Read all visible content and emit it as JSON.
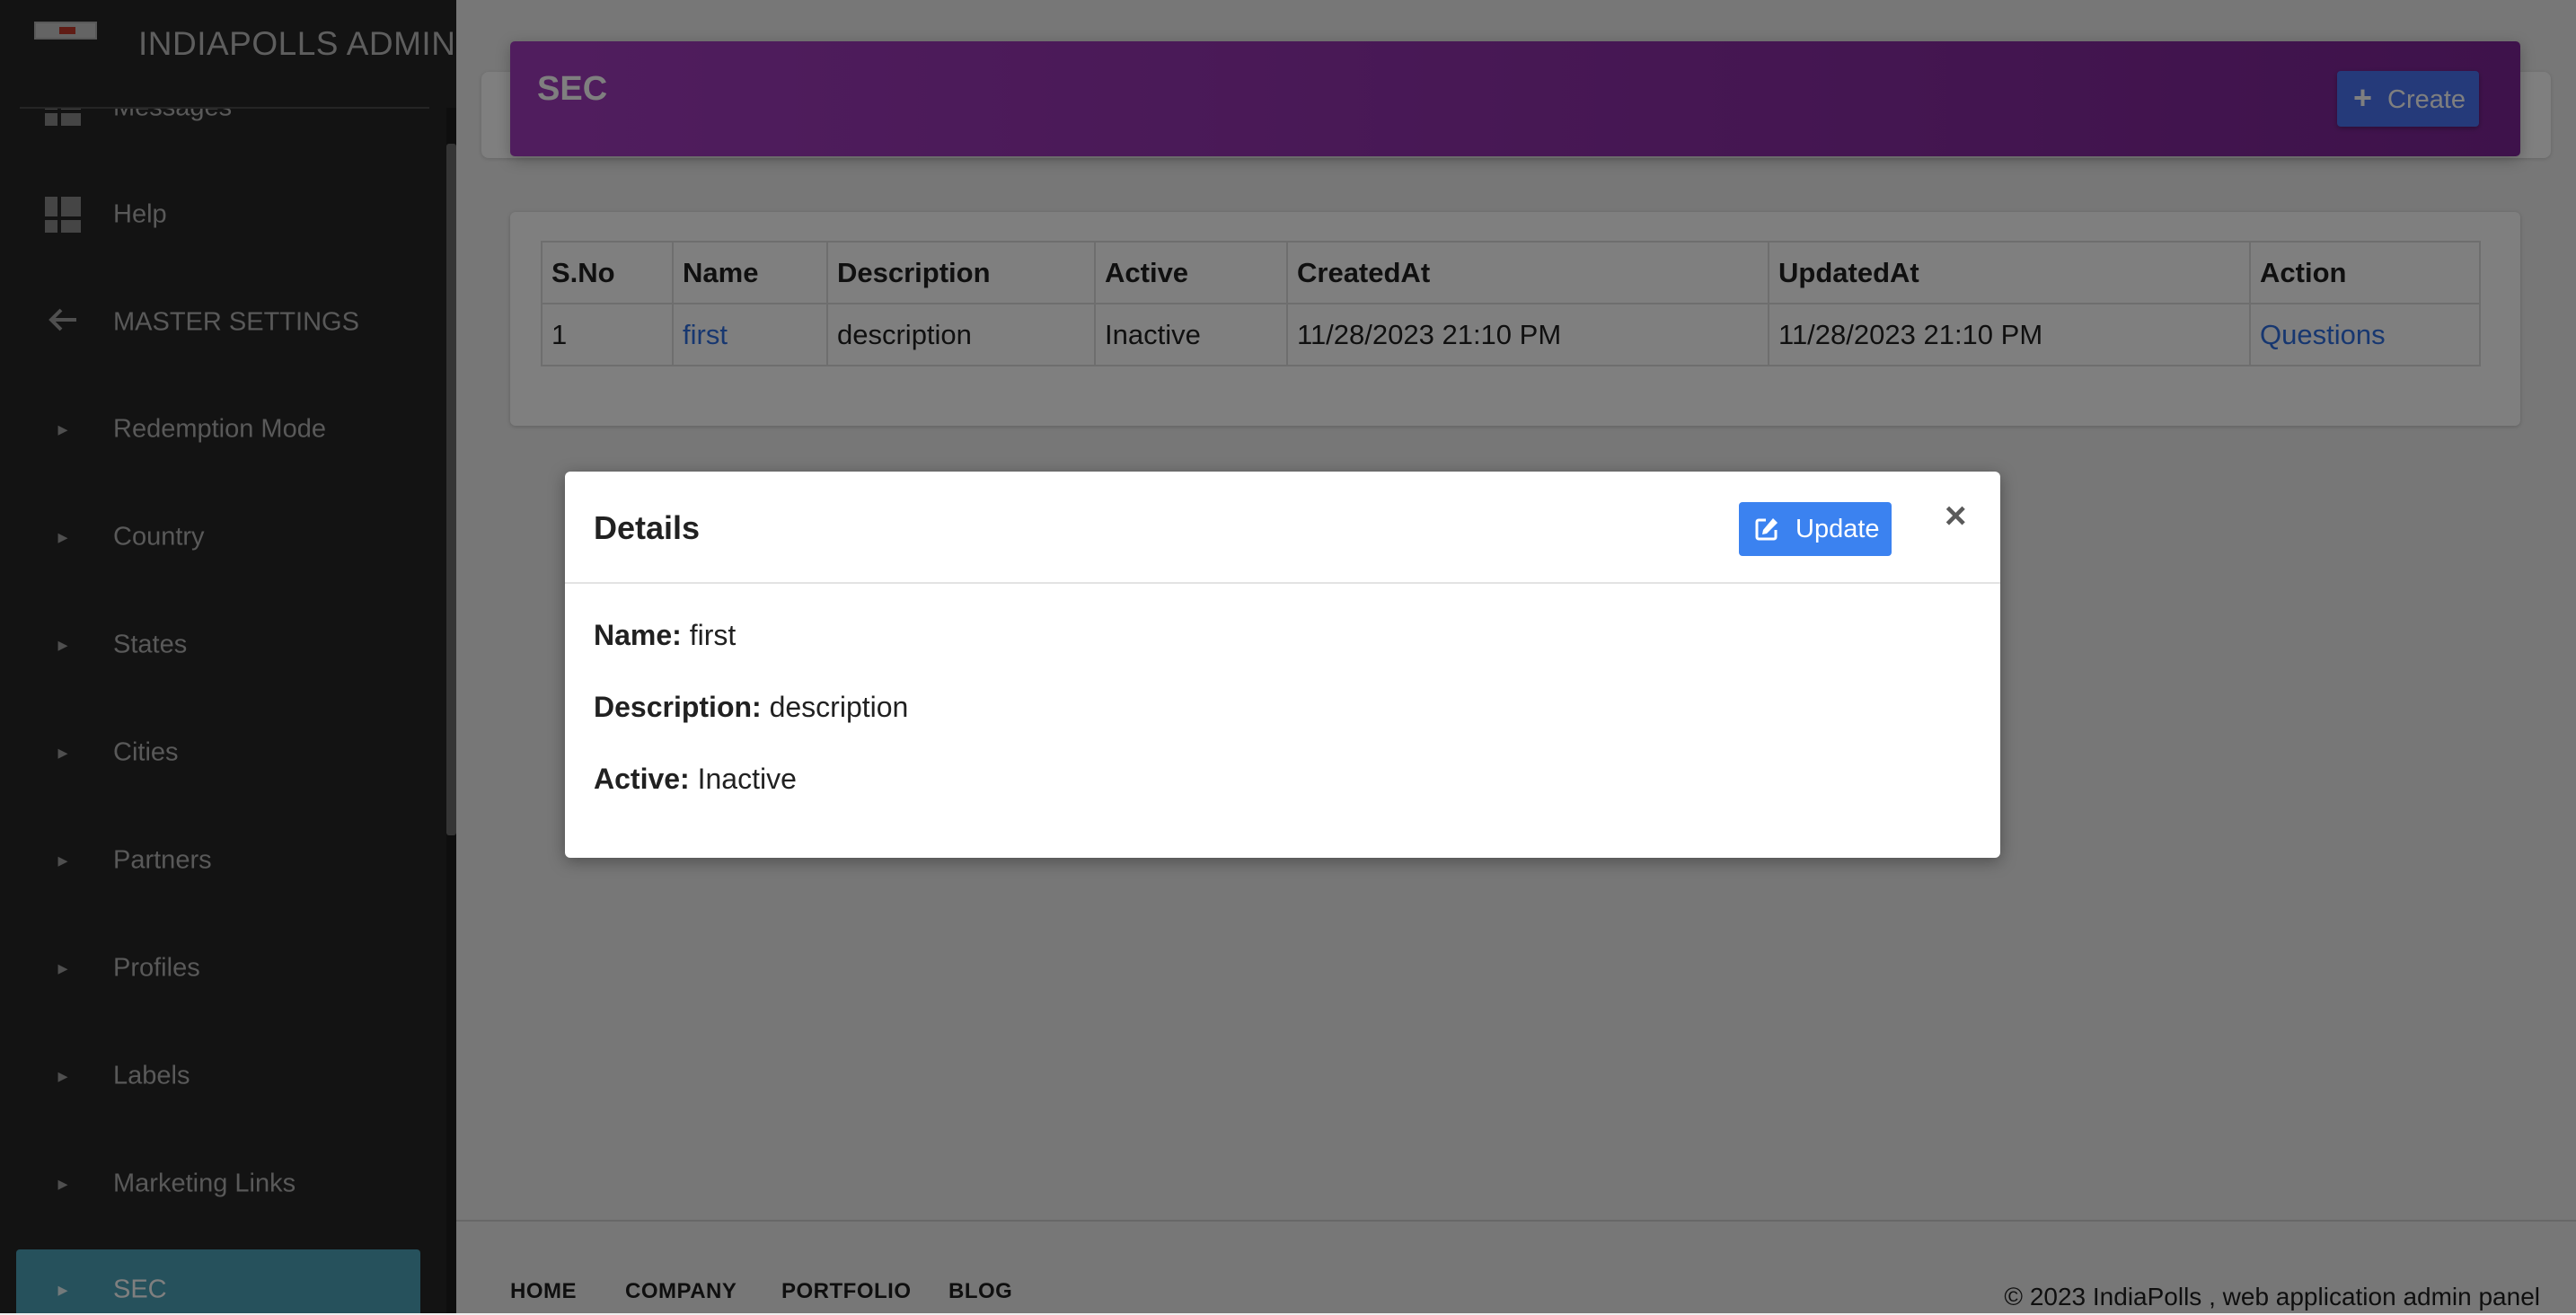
{
  "sidebar": {
    "brand": "INDIAPOLLS ADMIN",
    "items": [
      {
        "label": "Messages",
        "icon": "dashboard-icon"
      },
      {
        "label": "Help",
        "icon": "dashboard-icon"
      },
      {
        "label": "MASTER SETTINGS",
        "icon": "arrow-left-icon"
      },
      {
        "label": "Redemption Mode",
        "icon": "caret-right-icon"
      },
      {
        "label": "Country",
        "icon": "caret-right-icon"
      },
      {
        "label": "States",
        "icon": "caret-right-icon"
      },
      {
        "label": "Cities",
        "icon": "caret-right-icon"
      },
      {
        "label": "Partners",
        "icon": "caret-right-icon"
      },
      {
        "label": "Profiles",
        "icon": "caret-right-icon"
      },
      {
        "label": "Labels",
        "icon": "caret-right-icon"
      },
      {
        "label": "Marketing Links",
        "icon": "caret-right-icon"
      },
      {
        "label": "SEC",
        "icon": "caret-right-icon",
        "active": true
      }
    ]
  },
  "header": {
    "title": "SEC",
    "create_label": "Create"
  },
  "table": {
    "columns": [
      "S.No",
      "Name",
      "Description",
      "Active",
      "CreatedAt",
      "UpdatedAt",
      "Action"
    ],
    "rows": [
      {
        "sno": "1",
        "name": "first",
        "description": "description",
        "active": "Inactive",
        "created": "11/28/2023 21:10 PM",
        "updated": "11/28/2023 21:10 PM",
        "action": "Questions"
      }
    ]
  },
  "modal": {
    "title": "Details",
    "update_label": "Update",
    "close": "×",
    "fields": [
      {
        "label": "Name:",
        "value": "first"
      },
      {
        "label": "Description:",
        "value": "description"
      },
      {
        "label": "Active:",
        "value": "Inactive"
      }
    ]
  },
  "footer": {
    "links": [
      "HOME",
      "COMPANY",
      "PORTFOLIO",
      "BLOG"
    ],
    "copyright": "© 2023 IndiaPolls , web application admin panel"
  },
  "colors": {
    "header_gradient_start": "#a13bbd",
    "header_gradient_end": "#7d2596",
    "primary_button": "#3b82f0",
    "active_sidebar": "#4da3b8",
    "link": "#2f6fe0"
  }
}
